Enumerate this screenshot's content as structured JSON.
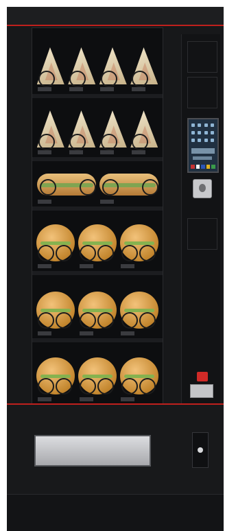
{
  "machine": {
    "accent_color": "#c0201d",
    "body_color": "#17181a"
  },
  "shelves": [
    {
      "product": "sandwich",
      "count": 4
    },
    {
      "product": "sandwich",
      "count": 4
    },
    {
      "product": "baguette",
      "count": 2
    },
    {
      "product": "roll",
      "count": 3
    },
    {
      "product": "roll",
      "count": 3
    },
    {
      "product": "roll",
      "count": 3
    }
  ],
  "side_panel": {
    "display_icon": "touch-screen-icon",
    "coin_icon": "coin-slot-icon",
    "logo_icon": "brand-logo-icon",
    "card_icon": "card-reader-icon"
  },
  "lower": {
    "flap_icon": "delivery-flap-icon",
    "return_icon": "coin-return-icon"
  }
}
